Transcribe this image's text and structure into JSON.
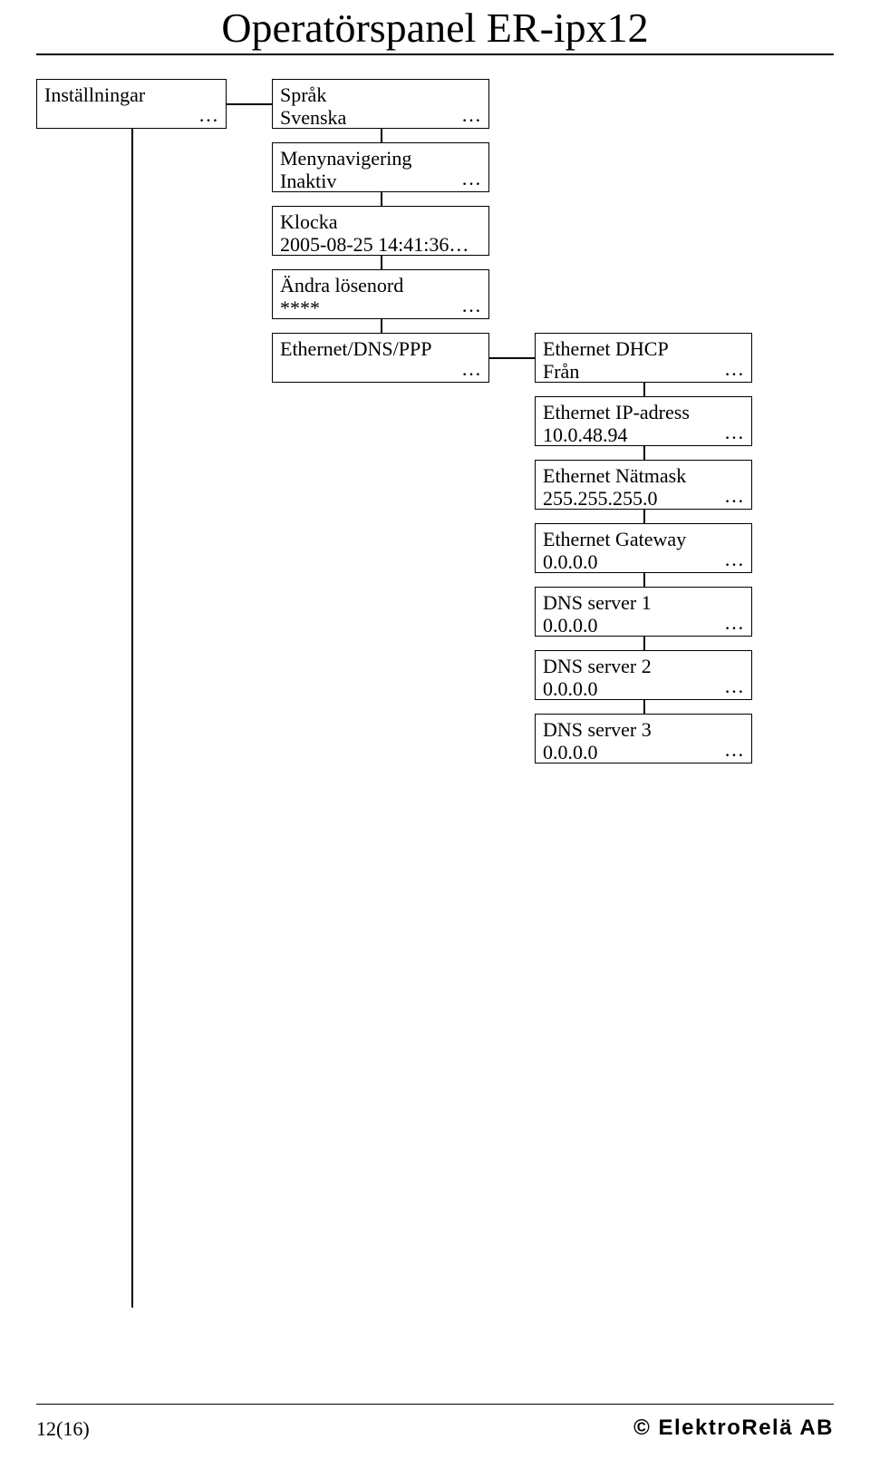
{
  "title": "Operatörspanel ER-ipx12",
  "root": {
    "label": "Inställningar"
  },
  "colA": [
    {
      "label": "Språk",
      "value": "Svenska"
    },
    {
      "label": "Menynavigering",
      "value": "Inaktiv"
    },
    {
      "label": "Klocka",
      "value": "2005-08-25 14:41:36…"
    },
    {
      "label": "Ändra lösenord",
      "value": "****"
    },
    {
      "label": "Ethernet/DNS/PPP",
      "value": ""
    }
  ],
  "colB": [
    {
      "label": "Ethernet DHCP",
      "value": "Från"
    },
    {
      "label": "Ethernet IP-adress",
      "value": "10.0.48.94"
    },
    {
      "label": "Ethernet Nätmask",
      "value": "255.255.255.0"
    },
    {
      "label": "Ethernet Gateway",
      "value": "0.0.0.0"
    },
    {
      "label": "DNS server 1",
      "value": "0.0.0.0"
    },
    {
      "label": "DNS server 2",
      "value": "0.0.0.0"
    },
    {
      "label": "DNS server 3",
      "value": "0.0.0.0"
    }
  ],
  "footer": {
    "left": "12(16)",
    "right": "© ElektroRelä AB"
  }
}
